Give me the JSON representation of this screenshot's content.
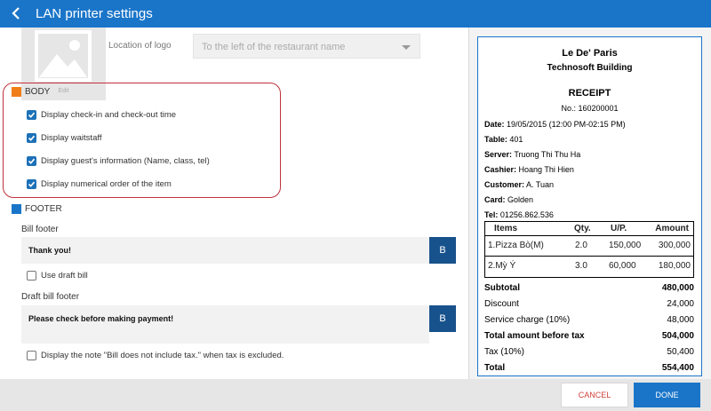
{
  "header": {
    "title": "LAN printer settings"
  },
  "logo": {
    "edit_label": "Edit",
    "location_label": "Location of logo",
    "location_value": "To the left of the restaurant name"
  },
  "body_section": {
    "title": "BODY",
    "color": "#f07e1a",
    "options": [
      {
        "label": "Display check-in and check-out time",
        "checked": true
      },
      {
        "label": "Display waitstaff",
        "checked": true
      },
      {
        "label": "Display guest's information (Name, class, tel)",
        "checked": true
      },
      {
        "label": "Display numerical order of the item",
        "checked": true
      }
    ]
  },
  "footer_section": {
    "title": "FOOTER",
    "color": "#1a75c9",
    "bill_footer_label": "Bill footer",
    "bill_footer_value": "Thank you!",
    "format_button": "B",
    "use_draft_label": "Use draft bill",
    "draft_footer_label": "Draft bill footer",
    "draft_footer_value": "Please check before making payment!",
    "tax_note_label": "Display the note \"Bill does not include tax.\" when tax is excluded."
  },
  "receipt": {
    "restaurant": "Le De' Paris",
    "address": "Technosoft Building",
    "title": "RECEIPT",
    "number": "No.: 160200001",
    "info": [
      {
        "key": "Date:",
        "value": "19/05/2015 (12:00 PM-02:15 PM)"
      },
      {
        "key": "Table:",
        "value": "401"
      },
      {
        "key": "Server:",
        "value": "Truong Thi Thu Ha"
      },
      {
        "key": "Cashier:",
        "value": "Hoang Thi Hien"
      },
      {
        "key": "Customer:",
        "value": "A. Tuan"
      },
      {
        "key": "Card:",
        "value": "Golden"
      },
      {
        "key": "Tel:",
        "value": "01256.862.536"
      }
    ],
    "columns": [
      "Items",
      "Qty.",
      "U/P.",
      "Amount"
    ],
    "items": [
      {
        "name": "1.Pizza Bò(M)",
        "qty": "2.0",
        "price": "150,000",
        "amount": "300,000"
      },
      {
        "name": "2.Mỳ Ý",
        "qty": "3.0",
        "price": "60,000",
        "amount": "180,000"
      }
    ],
    "summary": [
      {
        "label": "Subtotal",
        "value": "480,000",
        "bold": true
      },
      {
        "label": "Discount",
        "value": "24,000",
        "bold": false
      },
      {
        "label": "Service charge (10%)",
        "value": "48,000",
        "bold": false
      },
      {
        "label": "Total amount before tax",
        "value": "504,000",
        "bold": true
      },
      {
        "label": "Tax (10%)",
        "value": "50,400",
        "bold": false
      },
      {
        "label": "Total",
        "value": "554,400",
        "bold": true
      }
    ]
  },
  "actions": {
    "cancel": "CANCEL",
    "done": "DONE"
  }
}
